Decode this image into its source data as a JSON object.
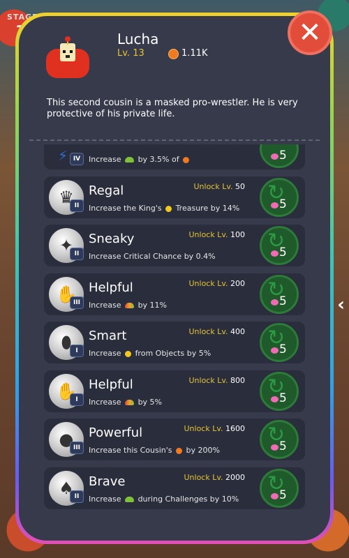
{
  "background": {
    "stage_label": "STAGE",
    "stage_number": "1",
    "right_arrow": "‹"
  },
  "close_button": {
    "glyph": "✕"
  },
  "cousin": {
    "name": "Lucha",
    "level": "Lv. 13",
    "gold": "1.11K",
    "description": "This second cousin is a masked pro-wrestler. He is very protective of his private life."
  },
  "colors": {
    "panel_bg": "#363a4b",
    "item_bg": "#2a2d3c",
    "accent_yellow": "#e6c436",
    "close_red": "#e24d3a",
    "upgrade_green": "#1e5a2a"
  },
  "partial_skill": {
    "tier": "IV",
    "desc_parts": [
      "Increase",
      "by 3.5% of"
    ],
    "icons": [
      "leaf-icon",
      "fruit-icon"
    ],
    "cost": "5"
  },
  "skills": [
    {
      "title": "Regal",
      "tier": "II",
      "unlock_label": "Unlock Lv.",
      "unlock_level": "50",
      "icon": "crown-icon",
      "desc_a": "Increase the King's",
      "desc_b": "Treasure by 14%",
      "cost": "5"
    },
    {
      "title": "Sneaky",
      "tier": "II",
      "unlock_label": "Unlock Lv.",
      "unlock_level": "100",
      "icon": "shuriken-icon",
      "desc_a": "Increase Critical Chance by 0.4%",
      "desc_b": "",
      "cost": "5"
    },
    {
      "title": "Helpful",
      "tier": "III",
      "unlock_label": "Unlock Lv.",
      "unlock_level": "200",
      "icon": "handshake-icon",
      "desc_a": "Increase",
      "desc_b": "by 11%",
      "cost": "5"
    },
    {
      "title": "Smart",
      "tier": "I",
      "unlock_label": "Unlock Lv.",
      "unlock_level": "400",
      "icon": "egg-icon",
      "desc_a": "Increase",
      "desc_b": "from Objects by 5%",
      "cost": "5"
    },
    {
      "title": "Helpful",
      "tier": "I",
      "unlock_label": "Unlock Lv.",
      "unlock_level": "800",
      "icon": "handshake-icon",
      "desc_a": "Increase",
      "desc_b": "by 5%",
      "cost": "5"
    },
    {
      "title": "Powerful",
      "tier": "III",
      "unlock_label": "Unlock Lv.",
      "unlock_level": "1600",
      "icon": "kettlebell-icon",
      "desc_a": "Increase this Cousin's",
      "desc_b": "by 200%",
      "cost": "5"
    },
    {
      "title": "Brave",
      "tier": "II",
      "unlock_label": "Unlock Lv.",
      "unlock_level": "2000",
      "icon": "cannon-icon",
      "desc_a": "Increase",
      "desc_b": "during Challenges by 10%",
      "cost": "5"
    }
  ]
}
